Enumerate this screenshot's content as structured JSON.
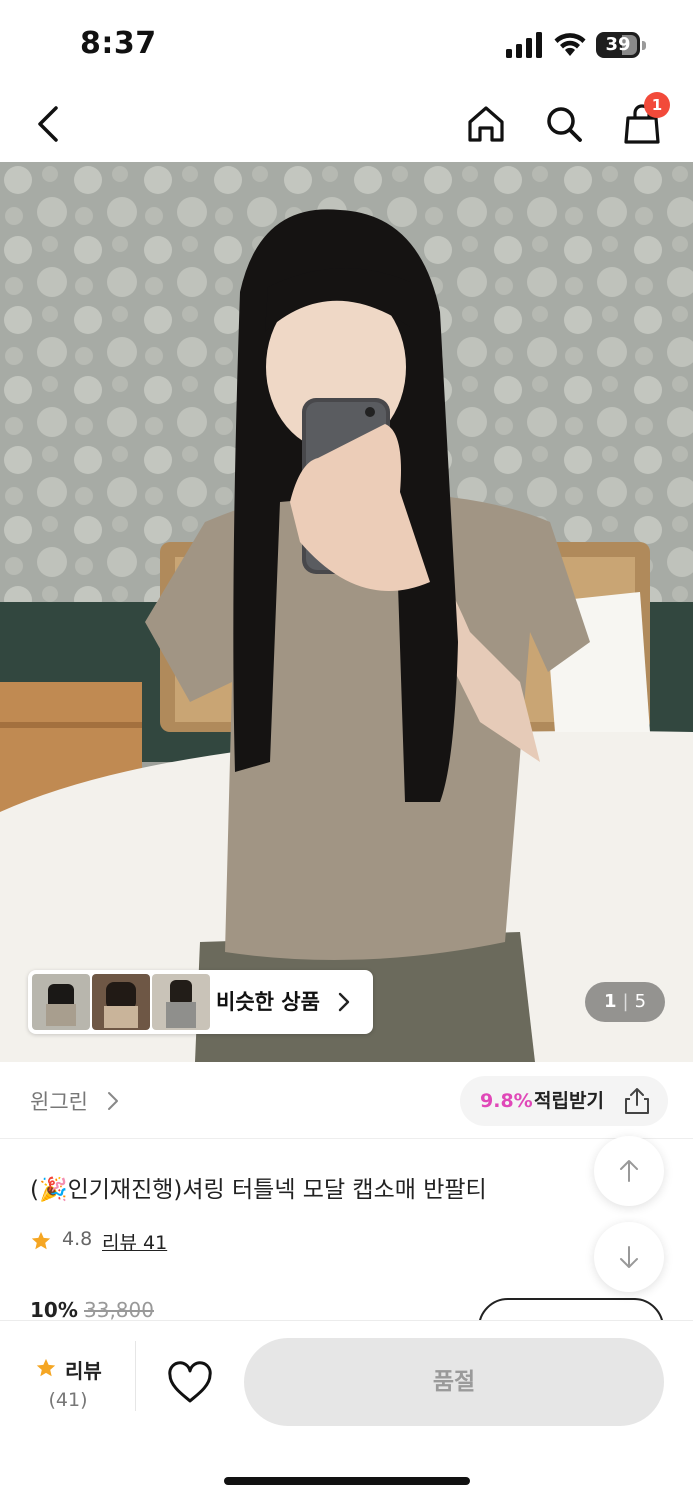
{
  "status_bar": {
    "time": "8:37",
    "battery": "39",
    "icons": [
      "signal-icon",
      "wifi-icon",
      "battery-icon"
    ]
  },
  "nav": {
    "icons": [
      "back-icon",
      "home-icon",
      "search-icon",
      "shopping-bag-icon"
    ],
    "cart_badge": "1"
  },
  "gallery": {
    "similar_label": "비슷한 상품",
    "current": "1",
    "total": "5"
  },
  "product": {
    "brand": "윈그린",
    "points_pct": "9.8%",
    "points_label": "적립받기",
    "title": "(🎉인기재진행)셔링 터틀넥 모달 캡소매 반팔티",
    "rating": "4.8",
    "review_link": "리뷰 41",
    "discount": "10%",
    "original_price": "33,800"
  },
  "bottom_bar": {
    "review_label": "리뷰",
    "review_count": "(41)",
    "soldout_label": "품절"
  },
  "colors": {
    "accent_pink": "#e048b8",
    "badge_red": "#f24a3a",
    "star": "#f5a623",
    "soldout_bg": "#e6e6e6"
  }
}
